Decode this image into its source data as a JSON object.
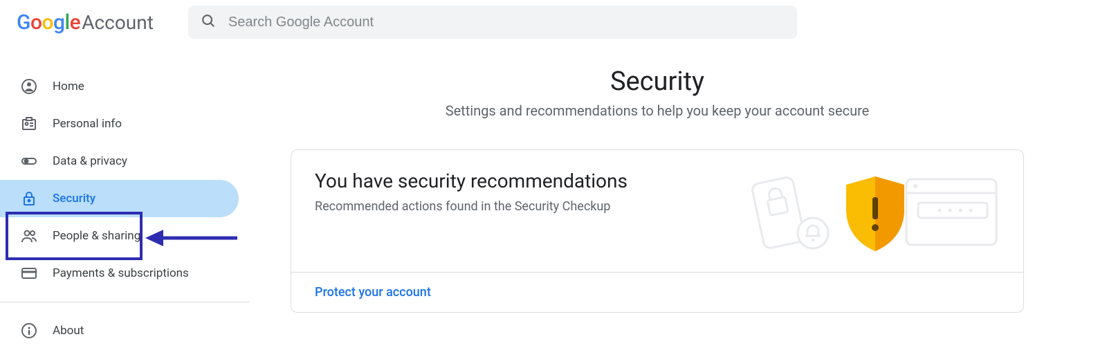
{
  "header": {
    "logo_google": "Google",
    "logo_account": "Account",
    "search_placeholder": "Search Google Account"
  },
  "sidebar": {
    "items": [
      {
        "label": "Home"
      },
      {
        "label": "Personal info"
      },
      {
        "label": "Data & privacy"
      },
      {
        "label": "Security"
      },
      {
        "label": "People & sharing"
      },
      {
        "label": "Payments & subscriptions"
      },
      {
        "label": "About"
      }
    ]
  },
  "main": {
    "title": "Security",
    "subtitle": "Settings and recommendations to help you keep your account secure",
    "card": {
      "title": "You have security recommendations",
      "desc": "Recommended actions found in the Security Checkup",
      "action": "Protect your account"
    }
  }
}
